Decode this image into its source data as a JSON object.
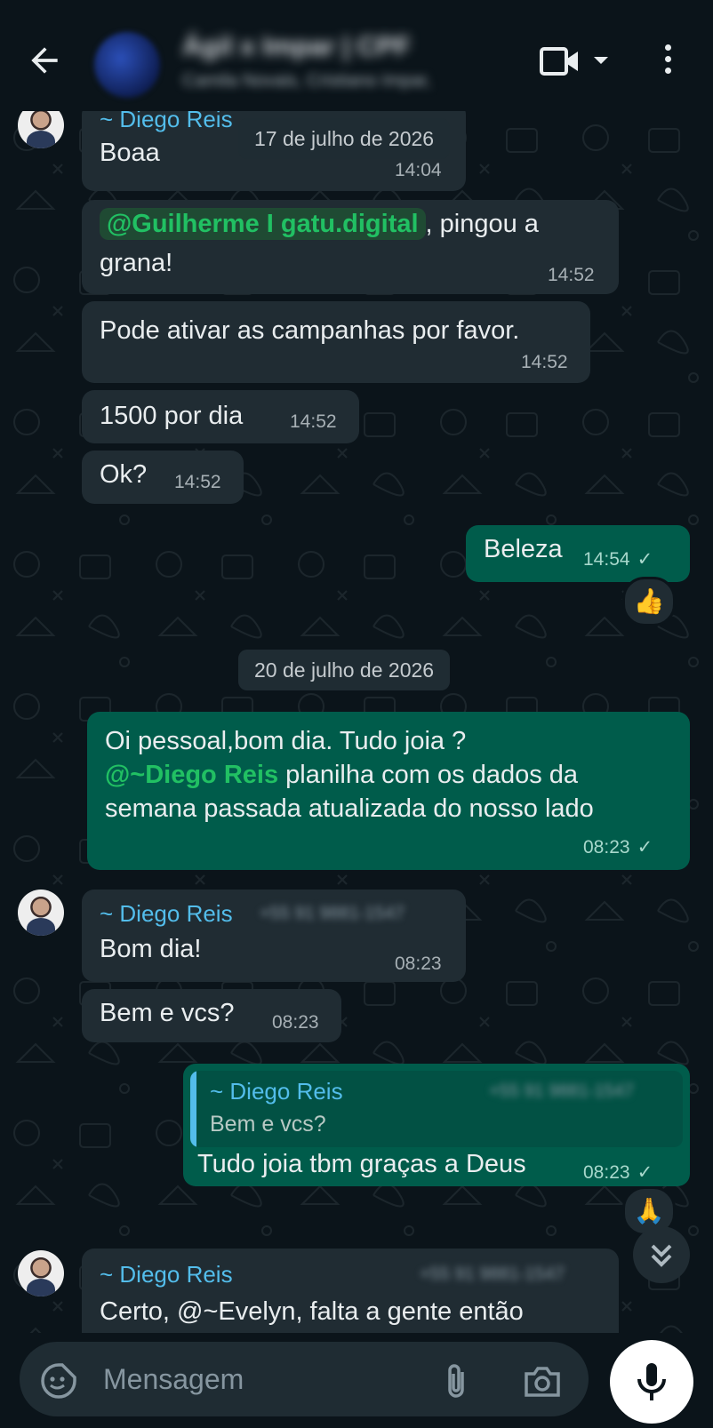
{
  "header": {
    "group_name": "Ágil x Impar | CPF",
    "participants": "Camila Novais, Cristiano Impar,"
  },
  "messages": {
    "m1": {
      "sender": "~ Diego Reis",
      "text": "Boaa",
      "time": "14:04"
    },
    "m2": {
      "mention": "@Guilherme I gatu.digital",
      "text_after": ", pingou a",
      "text_line2": "grana!",
      "time": "14:52"
    },
    "m3": {
      "text": "Pode ativar as campanhas por favor.",
      "time": "14:52"
    },
    "m4": {
      "text": "1500 por dia",
      "time": "14:52"
    },
    "m5": {
      "text": "Ok?",
      "time": "14:52"
    },
    "m6": {
      "text": "Beleza",
      "time": "14:54",
      "reaction": "👍"
    },
    "m7": {
      "line1": "Oi pessoal,bom dia. Tudo joia ?",
      "mention": "@~Diego Reis",
      "line2_after": " planilha com os dados da",
      "line3": "semana passada atualizada do nosso lado",
      "time": "08:23"
    },
    "m8": {
      "sender": "~ Diego Reis",
      "phone": "+55 91 9881-1547",
      "text": "Bom dia!",
      "time": "08:23"
    },
    "m9": {
      "text": "Bem e vcs?",
      "time": "08:23"
    },
    "m10": {
      "quote_sender": "~ Diego Reis",
      "quote_phone": "+55 91 9881-1547",
      "quote_text": "Bem e vcs?",
      "text": "Tudo joia tbm graças a Deus",
      "time": "08:23",
      "reaction": "🙏"
    },
    "m11": {
      "sender": "~ Diego Reis",
      "phone": "+55 91 9881-1547",
      "partial_text": "Certo, @~Evelyn, falta a gente então"
    }
  },
  "dates": {
    "d1": "17 de julho de 2026",
    "d2": "20 de julho de 2026"
  },
  "composer": {
    "placeholder": "Mensagem"
  },
  "colors": {
    "background": "#0b141a",
    "incoming_bubble": "#202c33",
    "outgoing_bubble": "#005c4b",
    "mention": "#21c063",
    "sender_name": "#53bdeb"
  },
  "icons": [
    "back-arrow-icon",
    "video-call-icon",
    "dropdown-caret-icon",
    "more-options-icon",
    "scroll-down-icon",
    "sticker-icon",
    "attach-icon",
    "camera-icon",
    "mic-icon",
    "read-check-icon"
  ]
}
